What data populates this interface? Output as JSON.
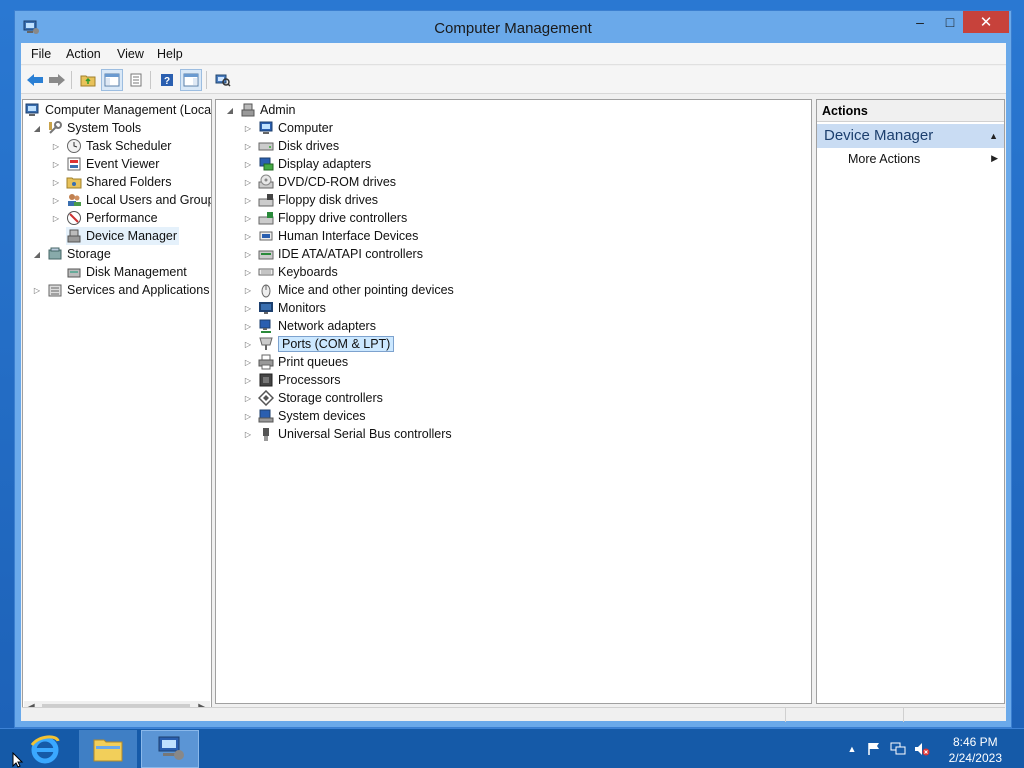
{
  "window": {
    "title": "Computer Management",
    "controls": {
      "minimize": "–",
      "maximize": "□",
      "close": "✕"
    }
  },
  "menu": [
    "File",
    "Action",
    "View",
    "Help"
  ],
  "left_tree": {
    "root": "Computer Management (Local",
    "items": [
      {
        "label": "System Tools",
        "level": 1,
        "expander": "expanded",
        "icon": "tools-icon"
      },
      {
        "label": "Task Scheduler",
        "level": 2,
        "expander": "collapsed",
        "icon": "clock-icon"
      },
      {
        "label": "Event Viewer",
        "level": 2,
        "expander": "collapsed",
        "icon": "event-viewer-icon"
      },
      {
        "label": "Shared Folders",
        "level": 2,
        "expander": "collapsed",
        "icon": "shared-folder-icon"
      },
      {
        "label": "Local Users and Groups",
        "level": 2,
        "expander": "collapsed",
        "icon": "users-icon"
      },
      {
        "label": "Performance",
        "level": 2,
        "expander": "collapsed",
        "icon": "performance-icon"
      },
      {
        "label": "Device Manager",
        "level": 2,
        "expander": "none",
        "icon": "device-manager-icon",
        "selected": true
      },
      {
        "label": "Storage",
        "level": 1,
        "expander": "expanded",
        "icon": "storage-icon"
      },
      {
        "label": "Disk Management",
        "level": 2,
        "expander": "none",
        "icon": "disk-management-icon"
      },
      {
        "label": "Services and Applications",
        "level": 1,
        "expander": "collapsed",
        "icon": "services-icon"
      }
    ]
  },
  "device_tree": {
    "root": "Admin",
    "categories": [
      {
        "label": "Computer",
        "icon": "computer-icon"
      },
      {
        "label": "Disk drives",
        "icon": "disk-drive-icon"
      },
      {
        "label": "Display adapters",
        "icon": "display-adapter-icon"
      },
      {
        "label": "DVD/CD-ROM drives",
        "icon": "dvd-icon"
      },
      {
        "label": "Floppy disk drives",
        "icon": "floppy-icon"
      },
      {
        "label": "Floppy drive controllers",
        "icon": "floppy-controller-icon"
      },
      {
        "label": "Human Interface Devices",
        "icon": "hid-icon"
      },
      {
        "label": "IDE ATA/ATAPI controllers",
        "icon": "ide-icon"
      },
      {
        "label": "Keyboards",
        "icon": "keyboard-icon"
      },
      {
        "label": "Mice and other pointing devices",
        "icon": "mouse-icon"
      },
      {
        "label": "Monitors",
        "icon": "monitor-icon"
      },
      {
        "label": "Network adapters",
        "icon": "network-adapter-icon"
      },
      {
        "label": "Ports (COM & LPT)",
        "icon": "port-icon",
        "selected": true
      },
      {
        "label": "Print queues",
        "icon": "printer-icon"
      },
      {
        "label": "Processors",
        "icon": "processor-icon"
      },
      {
        "label": "Storage controllers",
        "icon": "storage-controller-icon"
      },
      {
        "label": "System devices",
        "icon": "system-devices-icon"
      },
      {
        "label": "Universal Serial Bus controllers",
        "icon": "usb-icon"
      }
    ]
  },
  "actions": {
    "header": "Actions",
    "section": "Device Manager",
    "items": [
      {
        "label": "More Actions"
      }
    ]
  },
  "taskbar": {
    "apps": [
      {
        "name": "internet-explorer-icon"
      },
      {
        "name": "file-explorer-icon"
      },
      {
        "name": "computer-management-icon",
        "active": true
      }
    ],
    "clock": {
      "time": "8:46 PM",
      "date": "2/24/2023"
    }
  },
  "colors": {
    "title_bar": "#6aa9ea",
    "close_button": "#c7423b",
    "selection": "#cce8ff",
    "actions_section": "#c9dcf3",
    "taskbar": "#155aa8"
  }
}
